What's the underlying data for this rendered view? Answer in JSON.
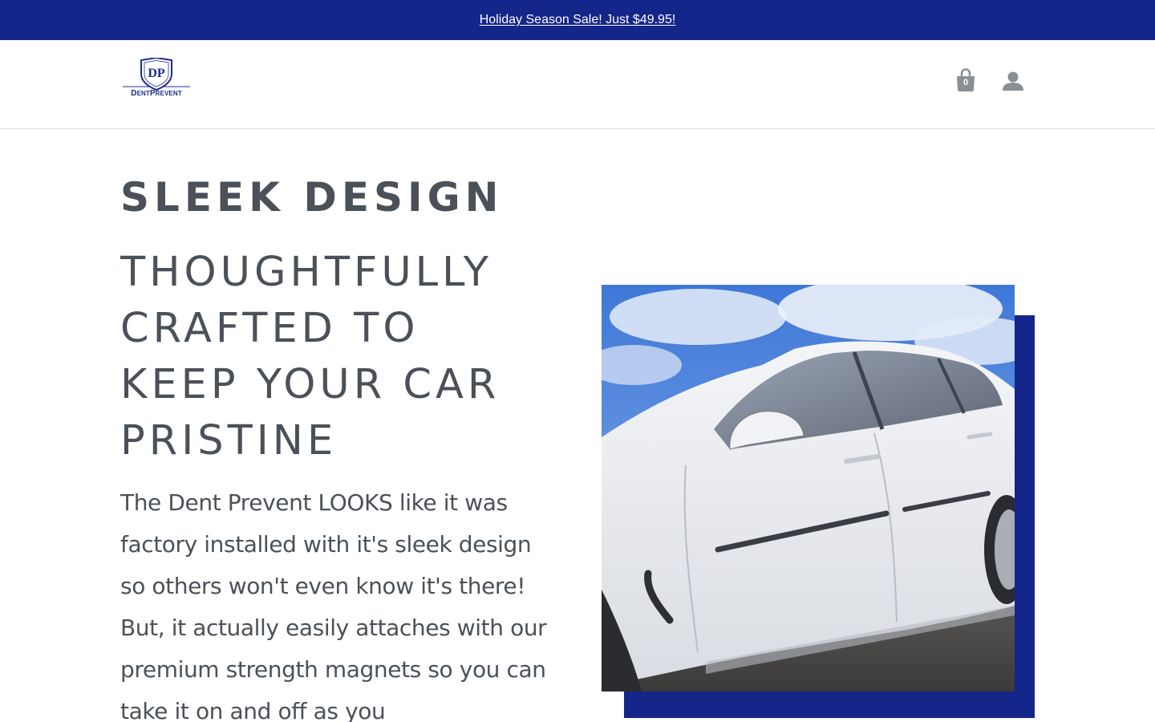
{
  "announcement": {
    "text": "Holiday Season Sale! Just $49.95!"
  },
  "header": {
    "logo_letters": "DP",
    "logo_name_first": "D",
    "logo_name_first_rest": "ENT",
    "logo_name_second": "P",
    "logo_name_second_rest": "REVENT",
    "cart_count": "0",
    "cart_icon": "shopping-bag-icon",
    "account_icon": "user-icon"
  },
  "section": {
    "eyebrow": "SLEEK DESIGN",
    "headline_lines": [
      "THOUGHTFULLY",
      "CRAFTED TO",
      "KEEP YOUR CAR",
      "PRISTINE"
    ],
    "body": "The Dent Prevent LOOKS like it was factory installed with it's sleek design so others won't even know it's there! But, it actually easily attaches with our premium strength magnets so you can take it on and off as you"
  },
  "colors": {
    "brand_blue": "#14268a",
    "text_gray": "#4a5158",
    "icon_gray": "#8a8f94"
  }
}
